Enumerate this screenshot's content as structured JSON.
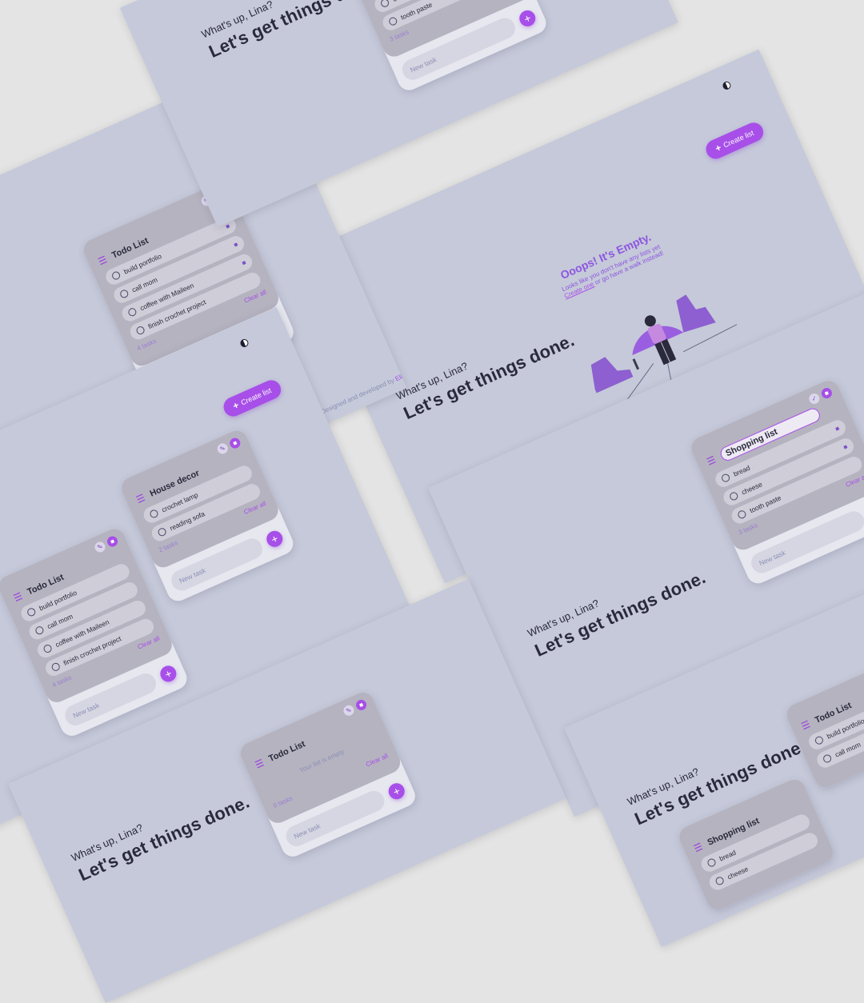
{
  "app": {
    "greeting": "What's up, Lina?",
    "headline": "Let's get things done.",
    "create_list_label": "Create list",
    "credit_prefix": "Designed and developed by",
    "credit_name": "Elina Rosato",
    "new_task_placeholder": "New task",
    "clear_all_label": "Clear all",
    "empty_list_note": "Your list is empty",
    "empty_title": "Ooops! It's Empty.",
    "empty_line1": "Looks like you don't have any lists yet",
    "empty_link": "Create one",
    "empty_line2": "or go have a walk instead!"
  },
  "colors": {
    "accent": "#a74fe8",
    "page_bg": "#c5c9d9",
    "card_top": "#b5b3c0",
    "text_dark": "#2a2a3c"
  },
  "icons": [
    "theme-toggle-icon",
    "plus-icon",
    "list-icon",
    "edit-icon",
    "trash-icon",
    "checkbox-icon"
  ],
  "lists": {
    "todo": {
      "title": "Todo List",
      "count_label": "4 tasks",
      "tasks": [
        "build portfolio",
        "call mom",
        "coffee with Maileen",
        "finish crochet project"
      ]
    },
    "shopping": {
      "title": "Shopping list",
      "count_label": "3 tasks",
      "tasks": [
        "bread",
        "cheese",
        "tooth paste"
      ]
    },
    "house": {
      "title": "House decor",
      "count_label": "2 tasks",
      "tasks": [
        "crochet lamp",
        "reading sofa"
      ]
    },
    "todo_empty": {
      "title": "Todo List",
      "count_label": "0 tasks"
    }
  }
}
